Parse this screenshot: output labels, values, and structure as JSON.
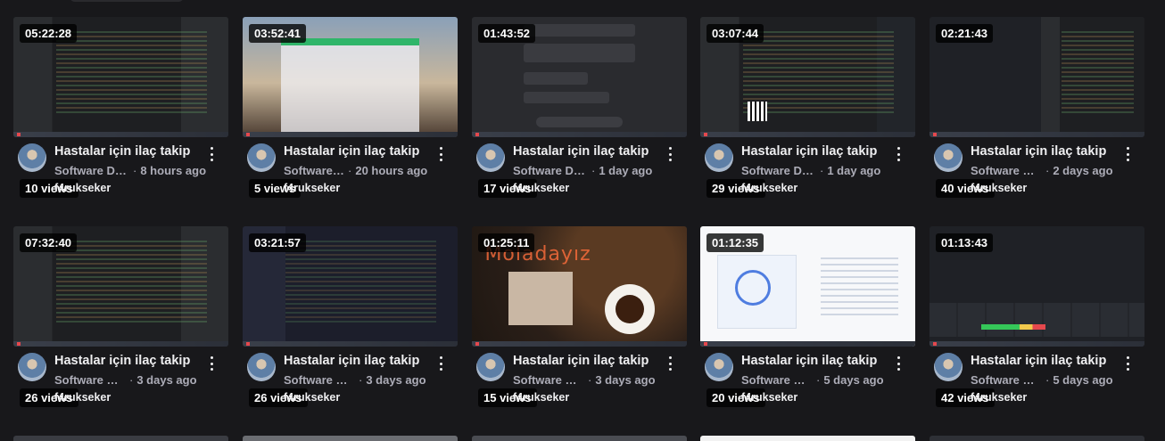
{
  "videos": [
    {
      "duration": "05:22:28",
      "views": "10 views",
      "title": "Hastalar için ilaç takip",
      "category": "Software Development",
      "ago": "8 hours ago",
      "tag": "f4rukseker"
    },
    {
      "duration": "03:52:41",
      "views": "5 views",
      "title": "Hastalar için ilaç takip",
      "category": "Software Development",
      "ago": "20 hours ago",
      "tag": "f4rukseker"
    },
    {
      "duration": "01:43:52",
      "views": "17 views",
      "title": "Hastalar için ilaç takip",
      "category": "Software Development",
      "ago": "1 day ago",
      "tag": "f4rukseker"
    },
    {
      "duration": "03:07:44",
      "views": "29 views",
      "title": "Hastalar için ilaç takip",
      "category": "Software Development",
      "ago": "1 day ago",
      "tag": "f4rukseker"
    },
    {
      "duration": "02:21:43",
      "views": "40 views",
      "title": "Hastalar için ilaç takip",
      "category": "Software Development",
      "ago": "2 days ago",
      "tag": "f4rukseker"
    },
    {
      "duration": "07:32:40",
      "views": "26 views",
      "title": "Hastalar için ilaç takip",
      "category": "Software Development",
      "ago": "3 days ago",
      "tag": "f4rukseker"
    },
    {
      "duration": "03:21:57",
      "views": "26 views",
      "title": "Hastalar için ilaç takip",
      "category": "Software Development",
      "ago": "3 days ago",
      "tag": "f4rukseker"
    },
    {
      "duration": "01:25:11",
      "views": "15 views",
      "title": "Hastalar için ilaç takip",
      "category": "Software Development",
      "ago": "3 days ago",
      "tag": "f4rukseker"
    },
    {
      "duration": "01:12:35",
      "views": "20 views",
      "title": "Hastalar için ilaç takip",
      "category": "Software Development",
      "ago": "5 days ago",
      "tag": "f4rukseker"
    },
    {
      "duration": "01:13:43",
      "views": "42 views",
      "title": "Hastalar için ilaç takip",
      "category": "Software Development",
      "ago": "5 days ago",
      "tag": "f4rukseker"
    }
  ],
  "thumb_text": {
    "coffee_word": "Moladayız"
  }
}
